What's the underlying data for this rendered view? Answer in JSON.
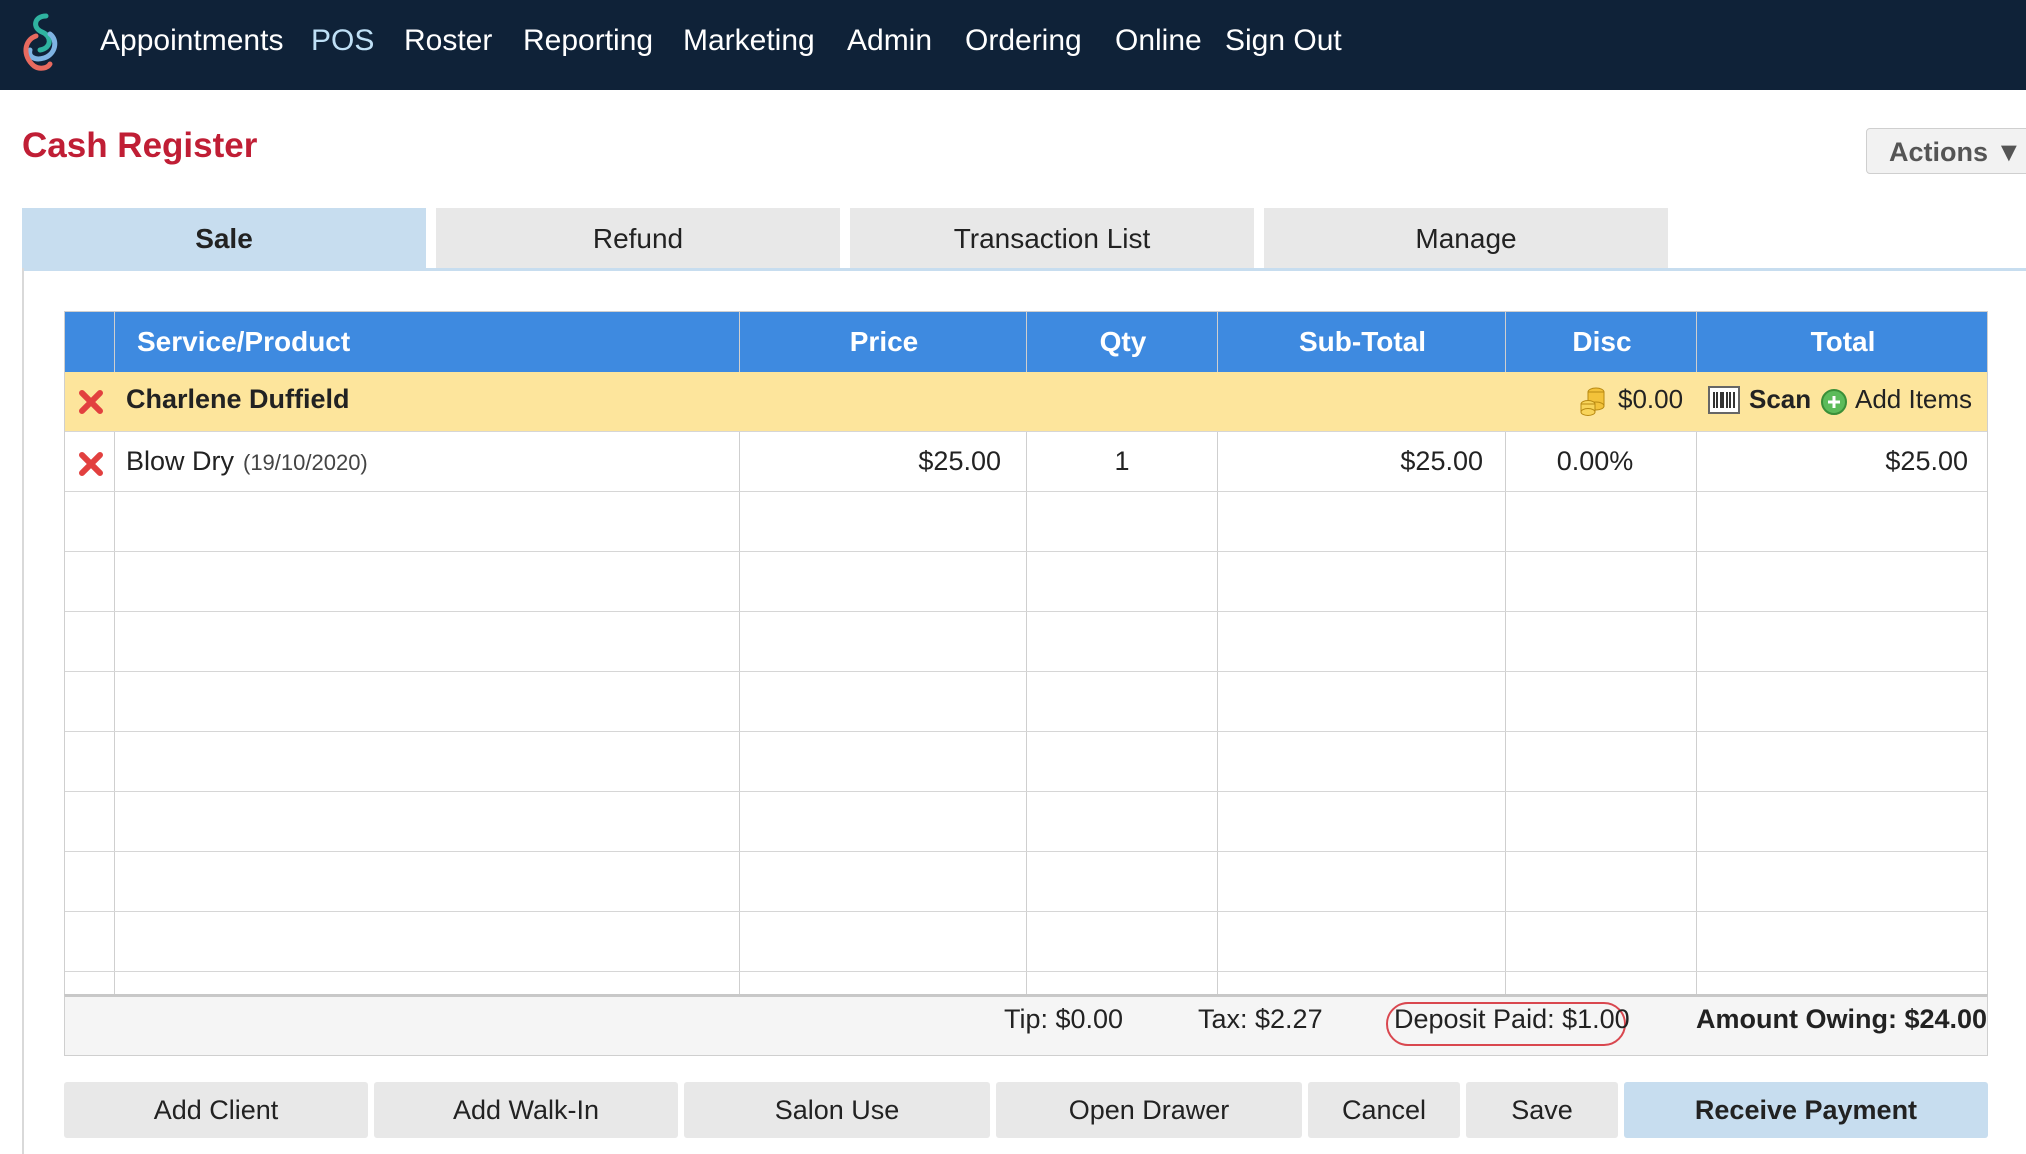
{
  "nav": {
    "items": [
      "Appointments",
      "POS",
      "Roster",
      "Reporting",
      "Marketing",
      "Admin",
      "Ordering",
      "Online",
      "Sign Out"
    ],
    "active": "POS"
  },
  "page": {
    "title": "Cash Register",
    "actions_label": "Actions ▼"
  },
  "tabs": [
    "Sale",
    "Refund",
    "Transaction List",
    "Manage"
  ],
  "table": {
    "headers": [
      "Service/Product",
      "Price",
      "Qty",
      "Sub-Total",
      "Disc",
      "Total"
    ],
    "client": {
      "name": "Charlene Duffield",
      "balance": "$0.00",
      "scan_label": "Scan",
      "add_items_label": "Add Items"
    },
    "rows": [
      {
        "service": "Blow Dry",
        "date": "(19/10/2020)",
        "price": "$25.00",
        "qty": "1",
        "subtotal": "$25.00",
        "disc": "0.00%",
        "total": "$25.00"
      }
    ]
  },
  "summary": {
    "tip": "Tip: $0.00",
    "tax": "Tax: $2.27",
    "deposit": "Deposit Paid: $1.00",
    "owing": "Amount Owing: $24.00"
  },
  "buttons": [
    "Add Client",
    "Add Walk-In",
    "Salon Use",
    "Open Drawer",
    "Cancel",
    "Save",
    "Receive Payment"
  ],
  "colors": {
    "nav_bg": "#0f2238",
    "title": "#c01e35",
    "header_bg": "#3e8ae0",
    "client_row": "#fde59c",
    "tab_active": "#c7ddef"
  }
}
